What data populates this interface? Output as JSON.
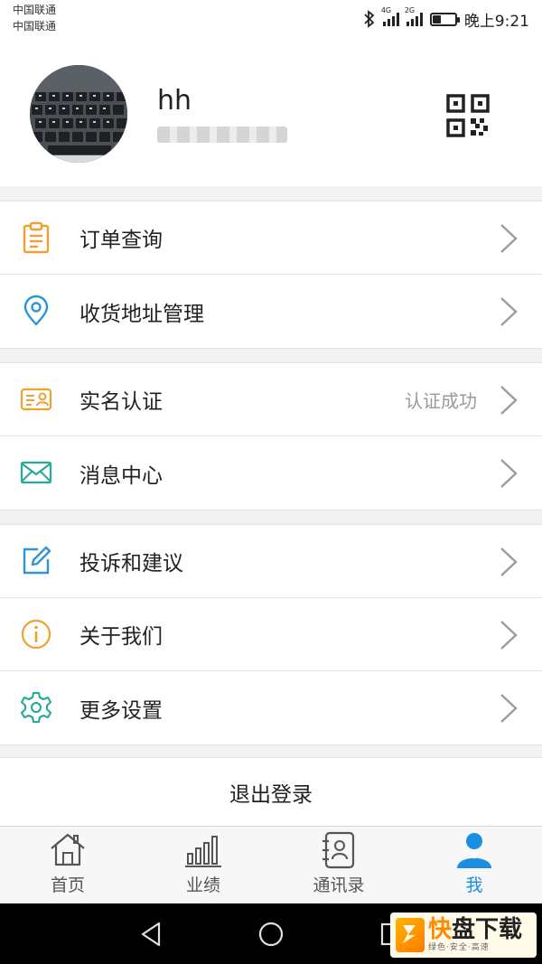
{
  "status_bar": {
    "carrier_1": "中国联通",
    "carrier_2": "中国联通",
    "net_1": "4G",
    "net_2": "2G",
    "battery_level": 0.35,
    "time": "晚上9:21"
  },
  "profile": {
    "username": "hh",
    "phone_masked": "1"
  },
  "menu": {
    "group_1": [
      {
        "label": "订单查询",
        "icon": "clipboard-icon"
      },
      {
        "label": "收货地址管理",
        "icon": "location-pin-icon"
      }
    ],
    "group_2": [
      {
        "label": "实名认证",
        "sub": "认证成功",
        "icon": "id-card-icon"
      },
      {
        "label": "消息中心",
        "icon": "envelope-icon"
      }
    ],
    "group_3": [
      {
        "label": "投诉和建议",
        "icon": "edit-icon"
      },
      {
        "label": "关于我们",
        "icon": "info-icon"
      },
      {
        "label": "更多设置",
        "icon": "gear-icon"
      }
    ]
  },
  "logout_label": "退出登录",
  "tabbar": {
    "tabs": [
      {
        "label": "首页",
        "icon": "home-icon"
      },
      {
        "label": "业绩",
        "icon": "bar-chart-icon"
      },
      {
        "label": "通讯录",
        "icon": "contacts-icon"
      },
      {
        "label": "我",
        "icon": "user-icon"
      }
    ],
    "active_index": 3
  },
  "watermark": {
    "logo_char": "快",
    "main": "盘下载",
    "sub": "绿色·安全·高速"
  },
  "colors": {
    "accent_blue": "#1a8ee0",
    "icon_orange": "#f0a030",
    "icon_blue": "#2f93d6",
    "icon_teal": "#27a99a",
    "chevron_gray": "#9c9c9c"
  }
}
